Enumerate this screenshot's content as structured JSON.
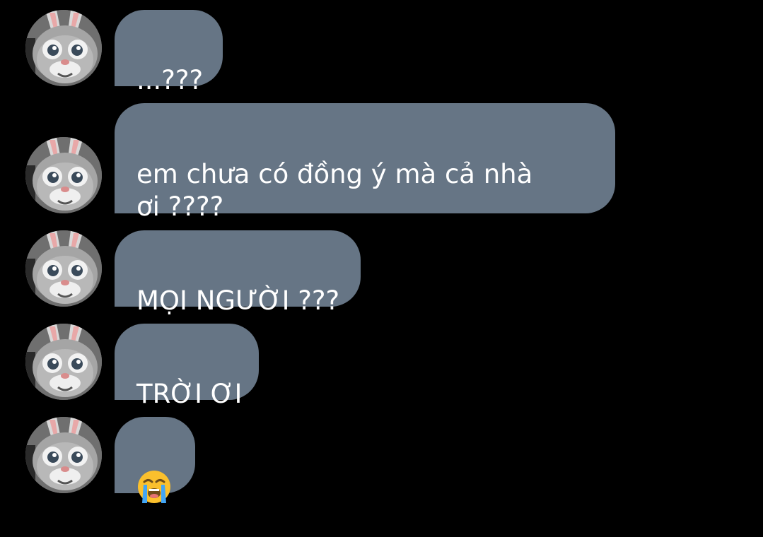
{
  "chat": {
    "messages": [
      {
        "text": "...???"
      },
      {
        "text": "em chưa có đồng ý mà cả nhà\nơi ????"
      },
      {
        "text": "MỌI NGƯỜI ???"
      },
      {
        "text": "TRỜI ƠI"
      },
      {
        "emoji": "loudly-crying-face-emoji"
      }
    ],
    "avatar_icon": "bunny-mascot-avatar",
    "bubble_color": "#667585",
    "background_color": "#000000",
    "text_color": "#ffffff"
  }
}
